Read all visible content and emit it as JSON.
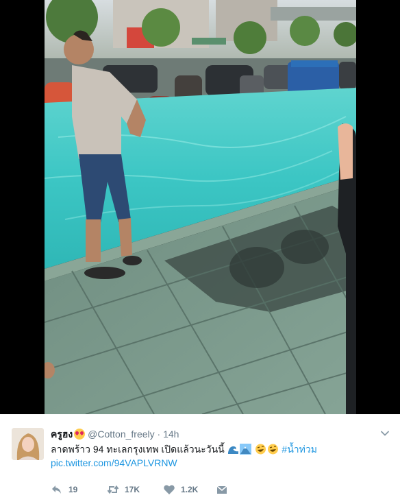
{
  "tweet": {
    "display_name": "ครูฮง",
    "handle": "@Cotton_freely",
    "separator": "·",
    "timestamp": "14h",
    "text": "ลาดพร้าว 94 ทะเลกรุงเทพ เปิดแล้วนะวันนี้",
    "hashtag": "#น้ำท่วม",
    "link": "pic.twitter.com/94VAPLVRNW",
    "reply_count": "19",
    "retweet_count": "17K",
    "like_count": "1.2K"
  },
  "icons": {
    "name_emoji": "heart-eyes-emoji",
    "text_emojis": [
      "water-wave-emoji",
      "mountain-emoji",
      "rofl-emoji",
      "rofl-emoji"
    ],
    "actions": [
      "reply-icon",
      "retweet-icon",
      "heart-icon",
      "direct-message-icon"
    ],
    "menu": "chevron-down-icon"
  },
  "colors": {
    "link": "#1b95e0",
    "secondary_text": "#657786",
    "primary_text": "#14171a",
    "media_background": "#000000",
    "flood_water": "#3cc7c5"
  }
}
